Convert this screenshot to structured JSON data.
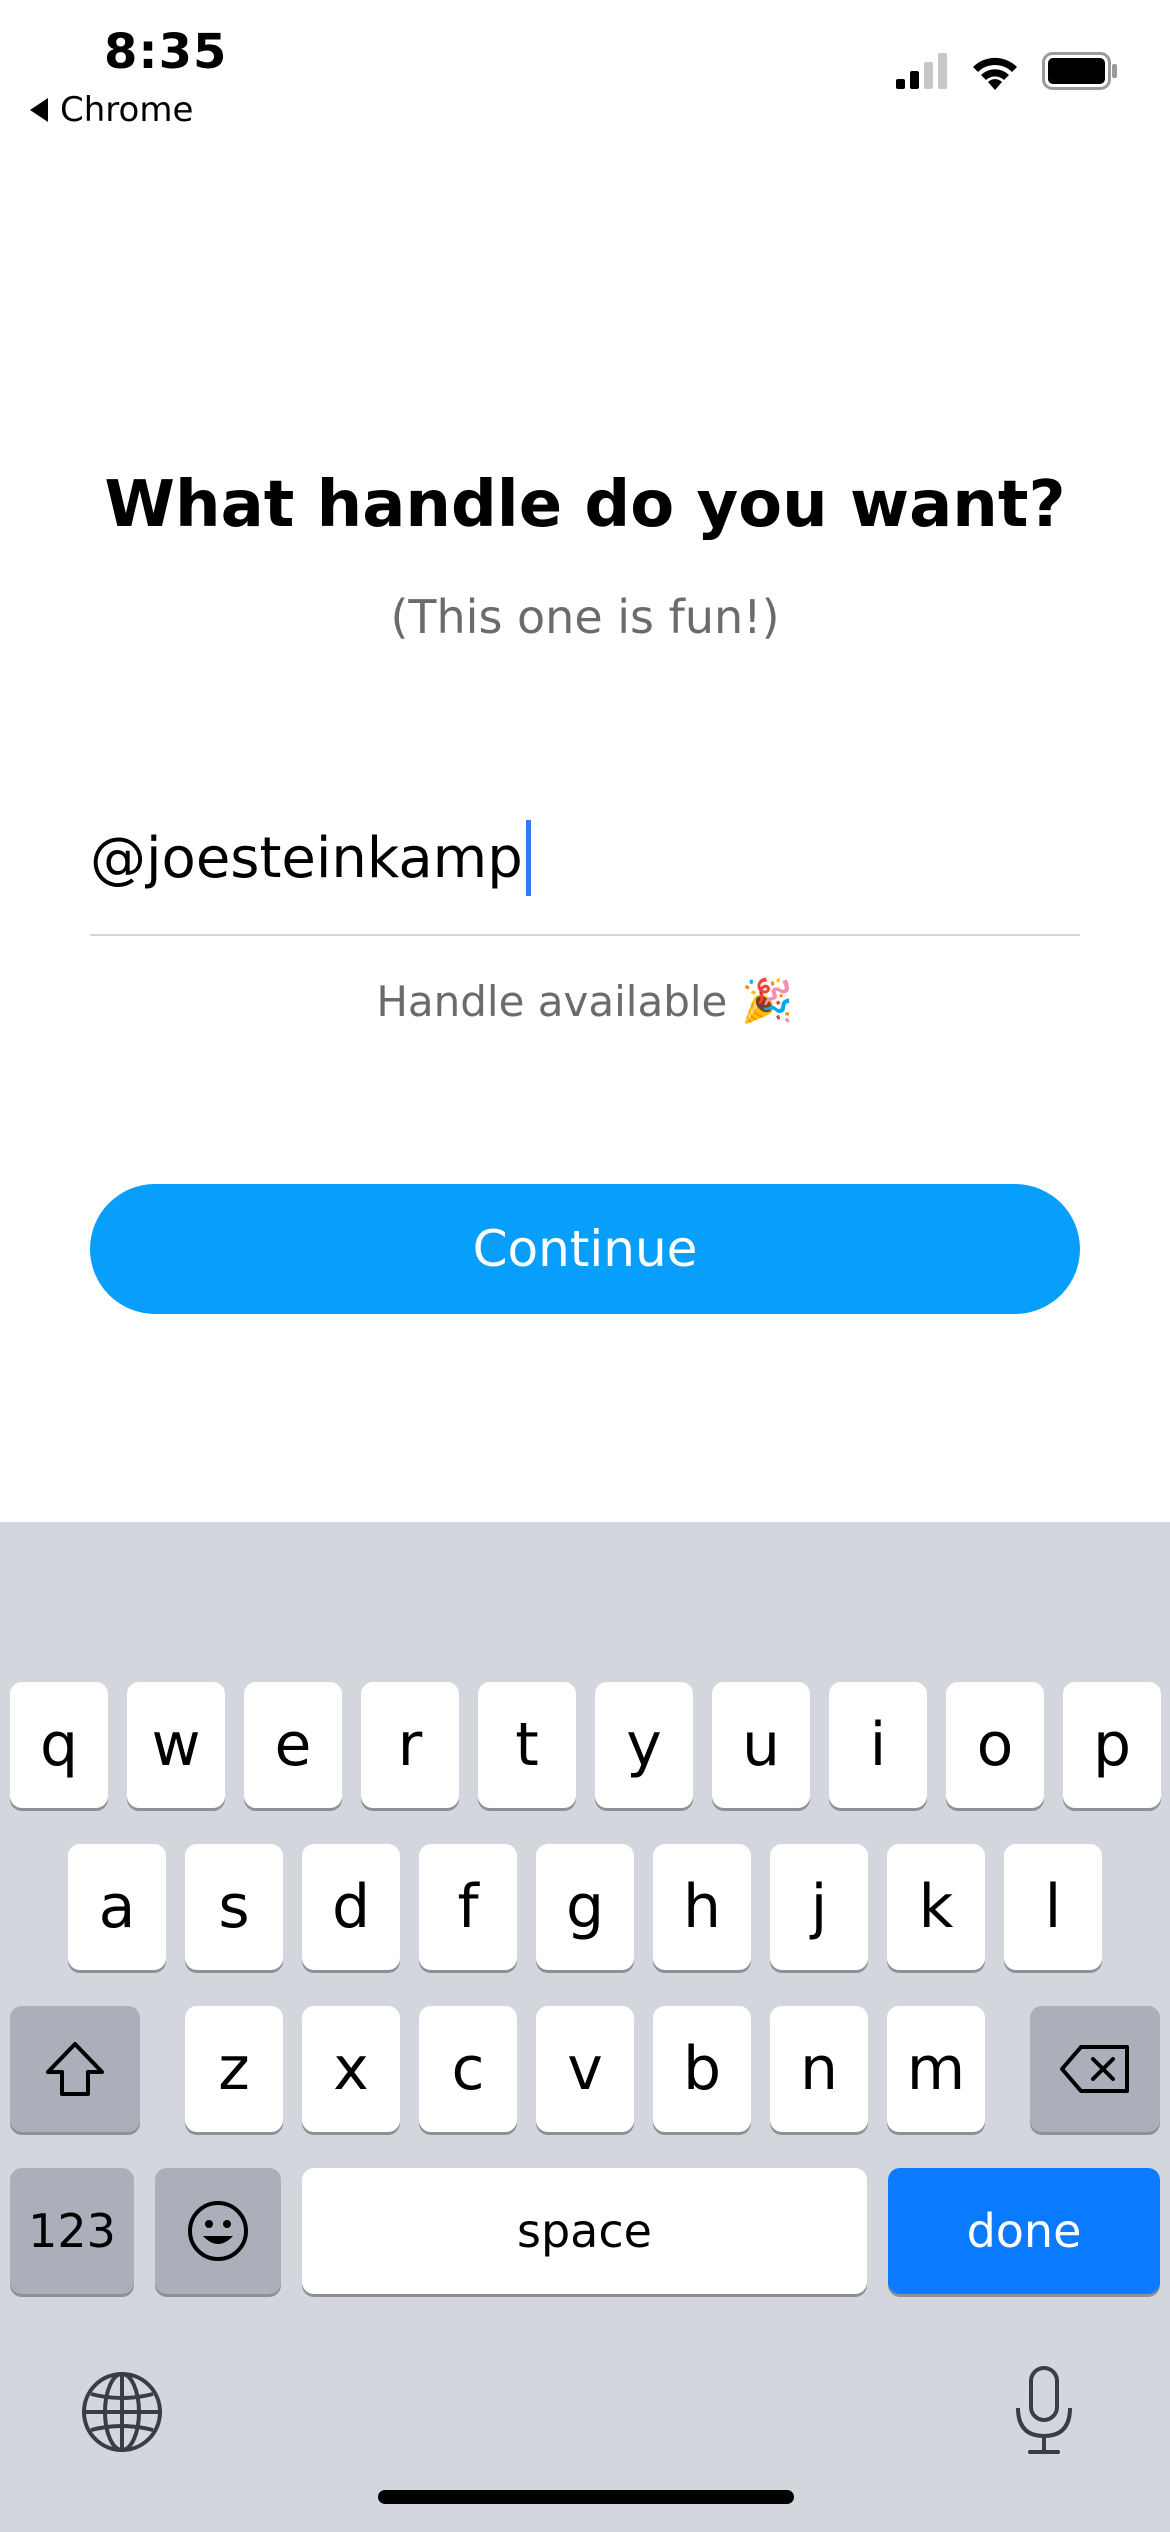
{
  "status_bar": {
    "time": "8:35",
    "back_label": "Chrome",
    "icons": [
      "signal-icon",
      "wifi-icon",
      "battery-icon"
    ]
  },
  "page": {
    "title": "What handle do you want?",
    "subtitle": "(This one is fun!)"
  },
  "handle_input": {
    "value": "@joesteinkamp"
  },
  "availability": {
    "text": "Handle available",
    "emoji": "🎉"
  },
  "continue_button": {
    "label": "Continue"
  },
  "keyboard": {
    "row1": [
      "q",
      "w",
      "e",
      "r",
      "t",
      "y",
      "u",
      "i",
      "o",
      "p"
    ],
    "row2": [
      "a",
      "s",
      "d",
      "f",
      "g",
      "h",
      "j",
      "k",
      "l"
    ],
    "row3": [
      "z",
      "x",
      "c",
      "v",
      "b",
      "n",
      "m"
    ],
    "numbers_label": "123",
    "space_label": "space",
    "done_label": "done"
  },
  "colors": {
    "accent": "#079ffb",
    "done_key": "#0a7bff",
    "caret": "#3478f6",
    "keyboard_bg": "#d3d6dc"
  }
}
